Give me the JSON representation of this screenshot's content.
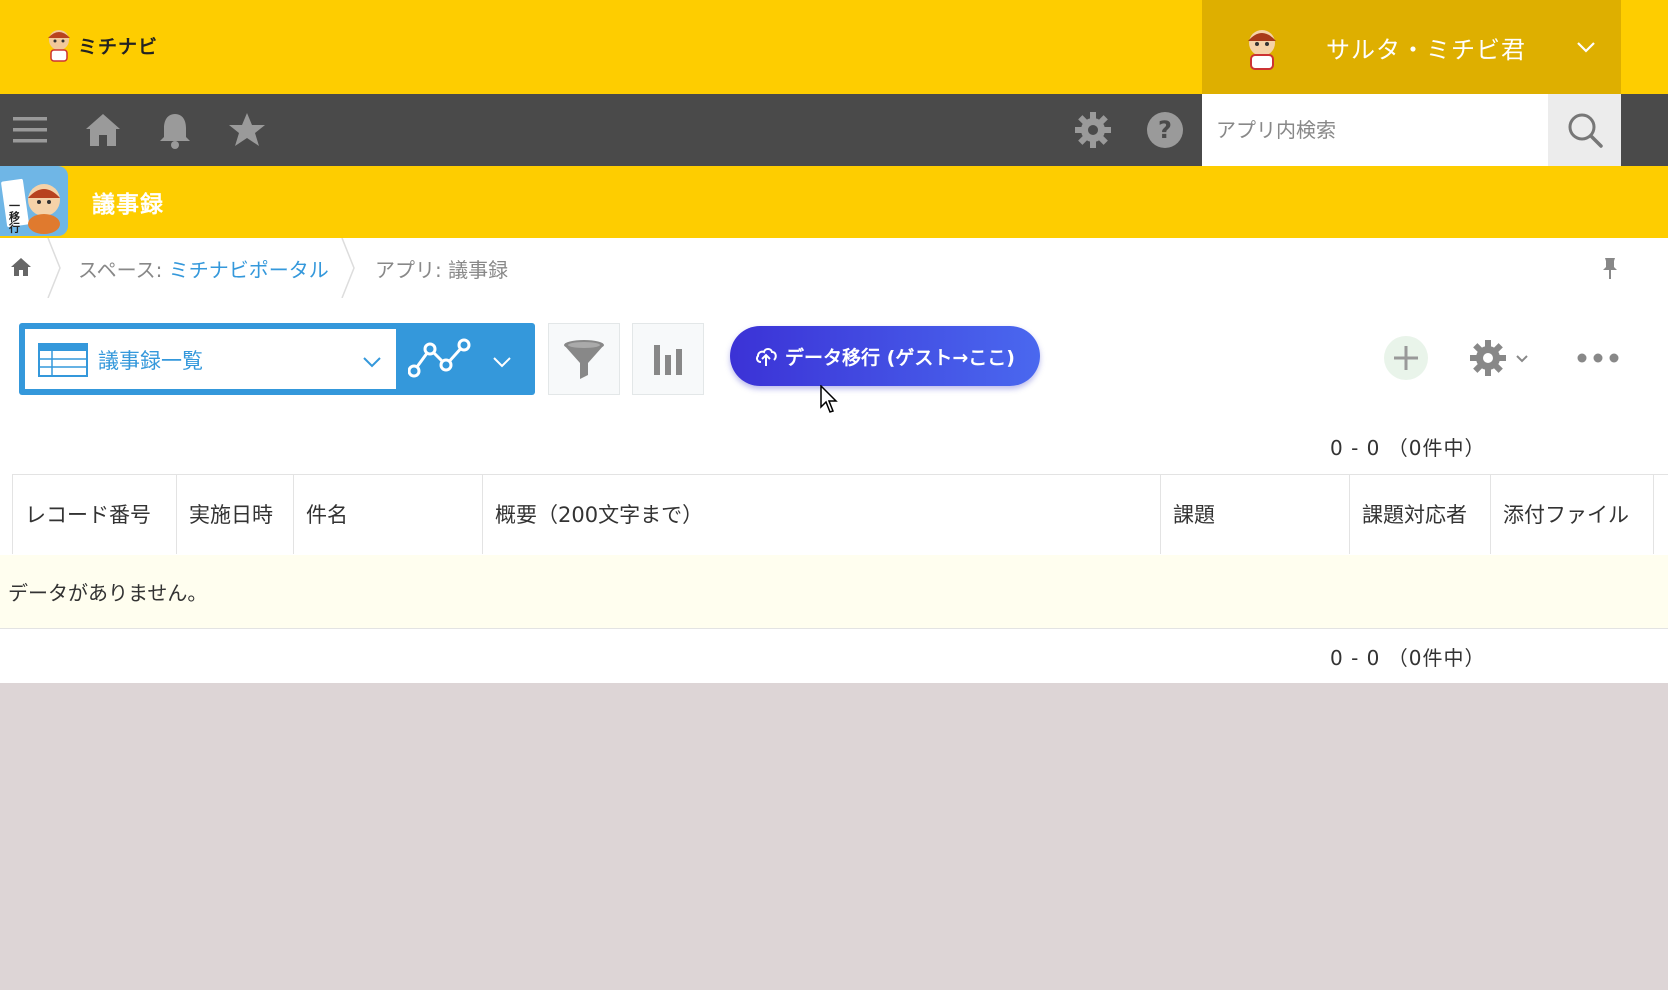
{
  "header": {
    "logo_text": "ミチナビ",
    "user_name": "サルタ・ミチビ君"
  },
  "navbar": {
    "icons": [
      "menu-icon",
      "home-icon",
      "bell-icon",
      "star-icon",
      "gear-icon",
      "help-icon"
    ],
    "search_placeholder": "アプリ内検索"
  },
  "app": {
    "title": "議事録",
    "icon_text": "一移行"
  },
  "breadcrumb": {
    "space_prefix": "スペース:",
    "space_name": "ミチナビポータル",
    "app": "アプリ: 議事録"
  },
  "toolbar": {
    "view_name": "議事録一覧",
    "migrate_label": "データ移行 (ゲスト→ここ)"
  },
  "pager": {
    "top": "0 - 0 （0件中）",
    "bottom": "0 - 0 （0件中）"
  },
  "table": {
    "columns": [
      "レコード番号",
      "実施日時",
      "件名",
      "概要（200文字まで）",
      "課題",
      "課題対応者",
      "添付ファイル"
    ],
    "empty_message": "データがありません。"
  },
  "colors": {
    "brand_yellow": "#fecd00",
    "nav_dark": "#4a4a4a",
    "accent_blue": "#3498db",
    "migrate_button": "#3b32d6"
  }
}
